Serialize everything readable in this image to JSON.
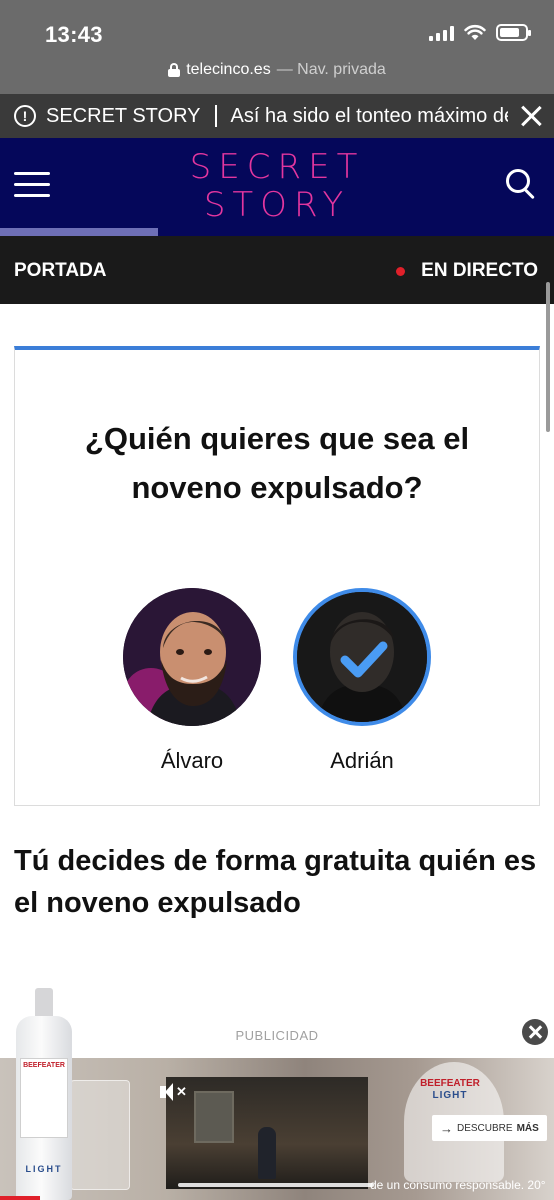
{
  "status_bar": {
    "time": "13:43",
    "battery_level": 0.8
  },
  "url_bar": {
    "domain": "telecinco.es",
    "suffix": " — Nav. privada"
  },
  "ticker": {
    "category": "SECRET STORY",
    "headline": "Así ha sido el tonteo máximo de S"
  },
  "header": {
    "logo_line1": "SECRET",
    "logo_line2": "STORY",
    "reading_progress": 0.285
  },
  "nav": {
    "portada": "PORTADA",
    "live": "EN DIRECTO",
    "live_dot_color": "#e0202a"
  },
  "poll": {
    "question": "¿Quién quieres que sea el noveno expulsado?",
    "accent_color": "#3b7ed8",
    "candidates": [
      {
        "name": "Álvaro",
        "selected": false
      },
      {
        "name": "Adrián",
        "selected": true
      }
    ]
  },
  "headline": "Tú decides de forma gratuita quién es el noveno expulsado",
  "ad": {
    "label": "PUBLICIDAD",
    "bottle_brand": "BEEFEATER",
    "bottle_variant": "LIGHT",
    "glass_brand": "BEEFEATER",
    "glass_variant": "LIGHT",
    "cta_prefix": "DESCUBRE ",
    "cta_bold": "MÁS",
    "disclaimer": "de un consumo responsable. 20°"
  }
}
